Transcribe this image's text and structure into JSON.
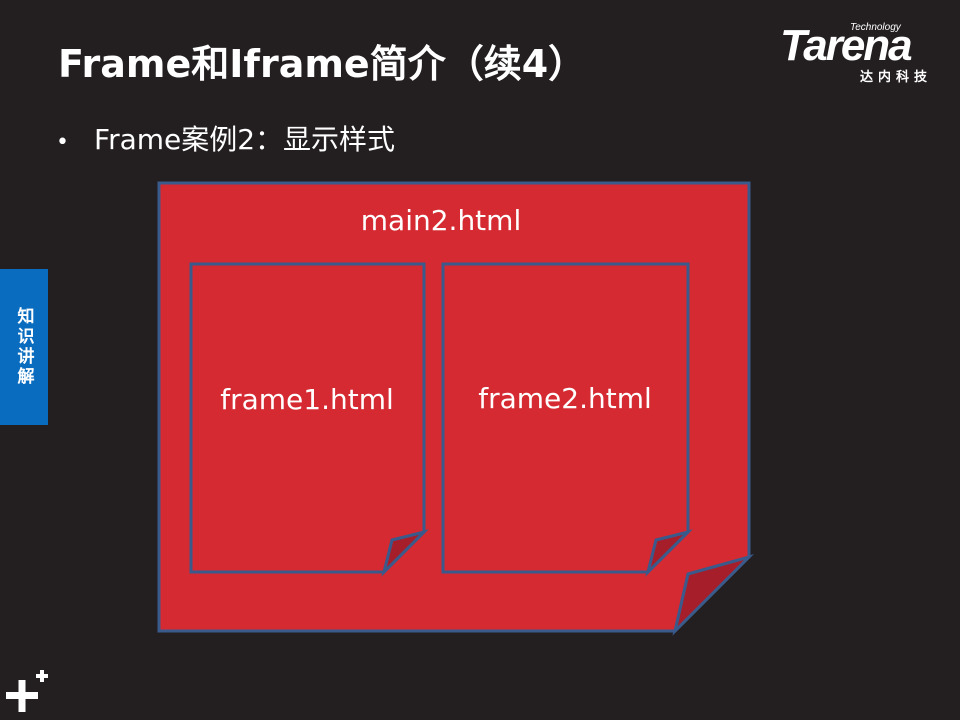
{
  "slide": {
    "title": "Frame和Iframe简介（续4）",
    "bullet": "Frame案例2：显示样式",
    "bullet_marker": "•"
  },
  "logo": {
    "brand": "Tarena",
    "tagline": "Technology",
    "chinese": "达内科技"
  },
  "side_tab": {
    "label": "知识讲解"
  },
  "diagram": {
    "outer_page": {
      "label": "main2.html"
    },
    "inner_pages": [
      {
        "label": "frame1.html"
      },
      {
        "label": "frame2.html"
      }
    ],
    "colors": {
      "page_fill": "#d52a32",
      "page_border": "#3b5a8c",
      "fold_fill": "#a61e2a"
    }
  },
  "colors": {
    "background": "#231f20",
    "side_tab": "#0a6cbf",
    "text": "#ffffff"
  }
}
